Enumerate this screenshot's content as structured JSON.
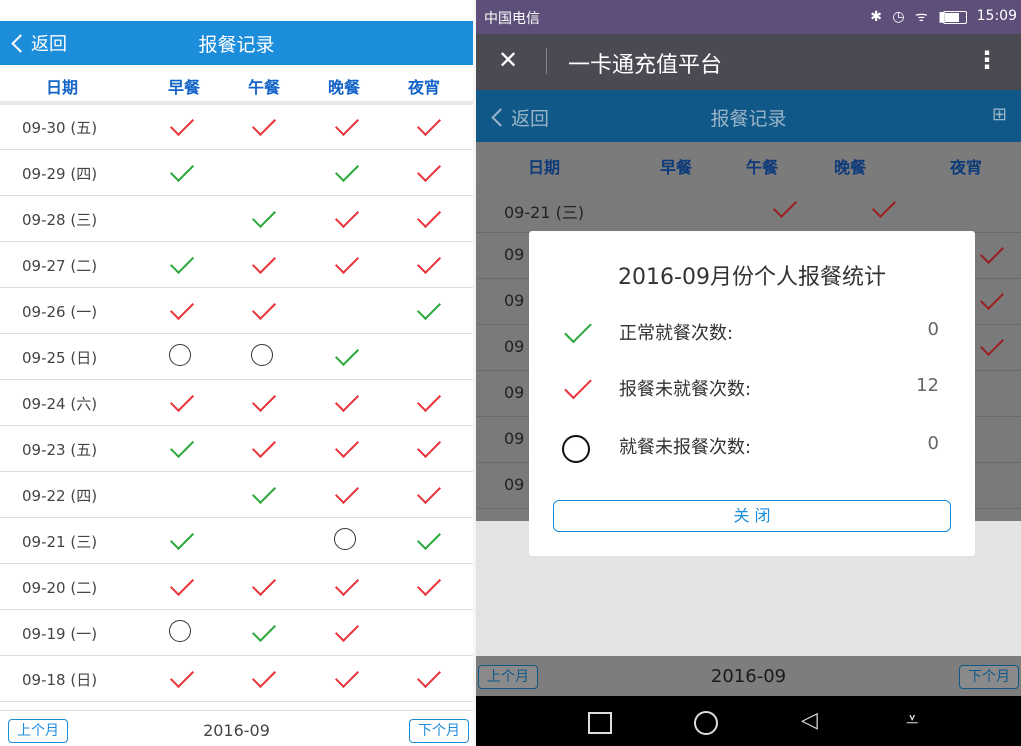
{
  "left": {
    "header": {
      "back_label": "返回",
      "title": "报餐记录"
    },
    "columns": [
      "日期",
      "早餐",
      "午餐",
      "晚餐",
      "夜宵"
    ],
    "rows": [
      {
        "date": "09-30 (五)",
        "marks": [
          "red",
          "red",
          "red",
          "red"
        ]
      },
      {
        "date": "09-29 (四)",
        "marks": [
          "green",
          "",
          "green",
          "red"
        ]
      },
      {
        "date": "09-28 (三)",
        "marks": [
          "",
          "green",
          "red",
          "red"
        ]
      },
      {
        "date": "09-27 (二)",
        "marks": [
          "green",
          "red",
          "red",
          "red"
        ]
      },
      {
        "date": "09-26 (一)",
        "marks": [
          "red",
          "red",
          "",
          "green"
        ]
      },
      {
        "date": "09-25 (日)",
        "marks": [
          "circle",
          "circle",
          "green",
          ""
        ]
      },
      {
        "date": "09-24 (六)",
        "marks": [
          "red",
          "red",
          "red",
          "red"
        ]
      },
      {
        "date": "09-23 (五)",
        "marks": [
          "green",
          "red",
          "red",
          "red"
        ]
      },
      {
        "date": "09-22 (四)",
        "marks": [
          "",
          "green",
          "red",
          "red"
        ]
      },
      {
        "date": "09-21 (三)",
        "marks": [
          "green",
          "",
          "circle",
          "green"
        ]
      },
      {
        "date": "09-20 (二)",
        "marks": [
          "red",
          "red",
          "red",
          "red"
        ]
      },
      {
        "date": "09-19 (一)",
        "marks": [
          "circle",
          "green",
          "red",
          ""
        ]
      },
      {
        "date": "09-18 (日)",
        "marks": [
          "red",
          "red",
          "red",
          "red"
        ]
      }
    ],
    "footer": {
      "prev_label": "上个月",
      "month": "2016-09",
      "next_label": "下个月"
    }
  },
  "right": {
    "status_bar": {
      "carrier": "中国电信",
      "time": "15:09"
    },
    "app_bar": {
      "close_icon": "close-icon",
      "title": "一卡通充值平台",
      "menu_icon": "more-vert-icon"
    },
    "header": {
      "back_label": "返回",
      "title": "报餐记录",
      "grid_icon": "grid-icon"
    },
    "columns": [
      "日期",
      "早餐",
      "午餐",
      "晚餐",
      "夜宵"
    ],
    "rows": [
      {
        "date": "09-21 (三)"
      },
      {
        "date": "09"
      },
      {
        "date": "09"
      },
      {
        "date": "09"
      },
      {
        "date": "09"
      },
      {
        "date": "09"
      },
      {
        "date": "09"
      }
    ],
    "dialog": {
      "title": "2016-09月份个人报餐统计",
      "items": [
        {
          "icon": "green-check-icon",
          "label": "正常就餐次数:",
          "count": "0"
        },
        {
          "icon": "red-check-icon",
          "label": "报餐未就餐次数:",
          "count": "12"
        },
        {
          "icon": "circle-icon",
          "label": "就餐未报餐次数:",
          "count": "0"
        }
      ],
      "close_label": "关 闭"
    },
    "footer": {
      "prev_label": "上个月",
      "month": "2016-09",
      "next_label": "下个月"
    }
  },
  "colors": {
    "accent": "#1c8ddb",
    "check_red": "#e8333a",
    "check_green": "#29a83a",
    "column_header": "#1464c8"
  }
}
